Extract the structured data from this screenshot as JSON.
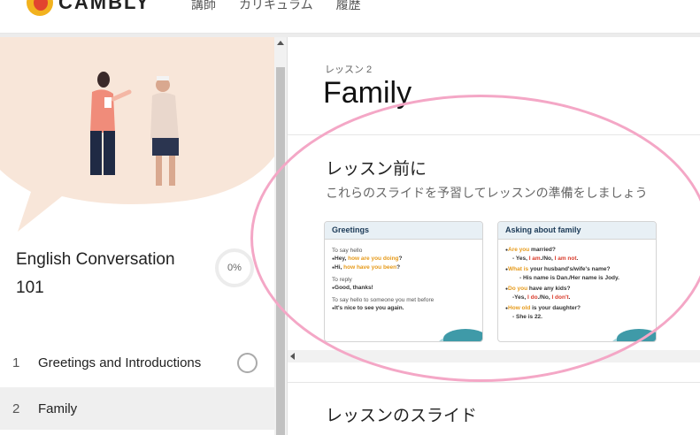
{
  "header": {
    "brand": "CAMBLY",
    "nav": [
      "講師",
      "カリキュラム",
      "履歴"
    ]
  },
  "sidebar": {
    "course_title": "English Conversation 101",
    "progress": "0%",
    "progress_value": 0,
    "lessons": [
      {
        "number": "1",
        "title": "Greetings and Introductions",
        "active": false
      },
      {
        "number": "2",
        "title": "Family",
        "active": true
      }
    ]
  },
  "main": {
    "lesson_number": "レッスン 2",
    "lesson_title": "Family",
    "before_title": "レッスン前に",
    "before_subtitle": "これらのスライドを予習してレッスンの準備をしましょう",
    "slides_title": "レッスンのスライド",
    "cards": [
      {
        "title": "Greetings",
        "label1": "To say hello",
        "l1a_pre": "Hey, ",
        "l1a_hl": "how are you doing",
        "l1a_post": "?",
        "l1b_pre": "Hi, ",
        "l1b_hl": "how have you been",
        "l1b_post": "?",
        "label2": "To reply",
        "l2a": "Good, thanks!",
        "label3": "To say hello to someone you met before",
        "l3a": "It's nice to see you again."
      },
      {
        "title": "Asking about family",
        "q1_hl": "Are you",
        "q1_post": " married?",
        "a1_pre": "Yes, ",
        "a1_hl": "I am",
        "a1_mid": "./No, ",
        "a1_hl2": "I am not",
        "a1_post": ".",
        "q2_hl": "What is",
        "q2_post": " your husband's/wife's name?",
        "a2": "His name is Dan./Her name is Jody.",
        "q3_hl": "Do you",
        "q3_post": " have any kids?",
        "a3_pre": "-Yes, ",
        "a3_hl": "I do",
        "a3_mid": "./No, ",
        "a3_hl2": "I don't",
        "a3_post": ".",
        "q4_hl": "How old",
        "q4_post": " is your daughter?",
        "a4": "She is 22."
      }
    ]
  },
  "colors": {
    "annotation": "#f4a7c6",
    "hero_bg": "#f8e6d9",
    "highlight_orange": "#e69a1a",
    "highlight_red": "#d93b2b"
  }
}
